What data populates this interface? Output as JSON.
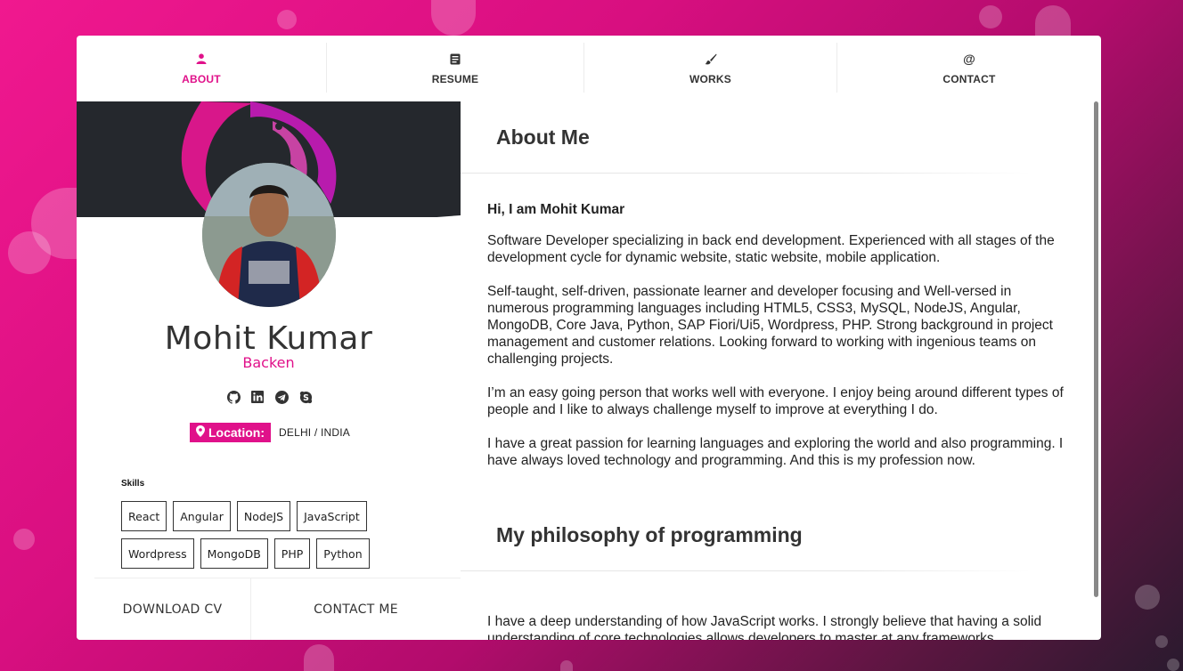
{
  "nav": [
    {
      "label": "ABOUT",
      "icon": "person-icon",
      "active": true
    },
    {
      "label": "RESUME",
      "icon": "document-icon",
      "active": false
    },
    {
      "label": "WORKS",
      "icon": "brush-icon",
      "active": false
    },
    {
      "label": "CONTACT",
      "icon": "at-icon",
      "active": false
    }
  ],
  "profile": {
    "name": "Mohit Kumar",
    "role": "Backen",
    "location_label": "Location:",
    "location_value": "DELHI / INDIA",
    "socials": [
      "github-icon",
      "linkedin-icon",
      "telegram-icon",
      "skype-icon"
    ]
  },
  "skills": {
    "title": "Skills",
    "row1": [
      "React",
      "Angular",
      "NodeJS",
      "JavaScript"
    ],
    "row2": [
      "Wordpress",
      "MongoDB",
      "PHP",
      "Python"
    ]
  },
  "actions": {
    "download": "DOWNLOAD CV",
    "contact": "CONTACT ME"
  },
  "about": {
    "title": "About Me",
    "greeting": "Hi, I am Mohit Kumar",
    "p1": "Software Developer specializing in back end development. Experienced with all stages of the development cycle for dynamic website, static website, mobile application.",
    "p2": "Self-taught, self-driven, passionate learner and developer focusing and Well-versed in numerous programming languages including HTML5, CSS3, MySQL, NodeJS, Angular, MongoDB, Core Java, Python, SAP Fiori/Ui5, Wordpress, PHP. Strong background in project management and customer relations. Looking forward to working with ingenious teams on challenging projects.",
    "p3": "I’m an easy going person that works well with everyone. I enjoy being around different types of people and I like to always challenge myself to improve at everything I do.",
    "p4": "I have a great passion for learning languages and exploring the world and also programming. I have always loved technology and programming. And this is my profession now."
  },
  "philosophy": {
    "title": "My philosophy of programming",
    "p1": "I have a deep understanding of how JavaScript works. I strongly believe that having a solid understanding of core technologies allows developers to master at any frameworks."
  },
  "colors": {
    "accent": "#e0118a",
    "dark": "#25282d"
  }
}
